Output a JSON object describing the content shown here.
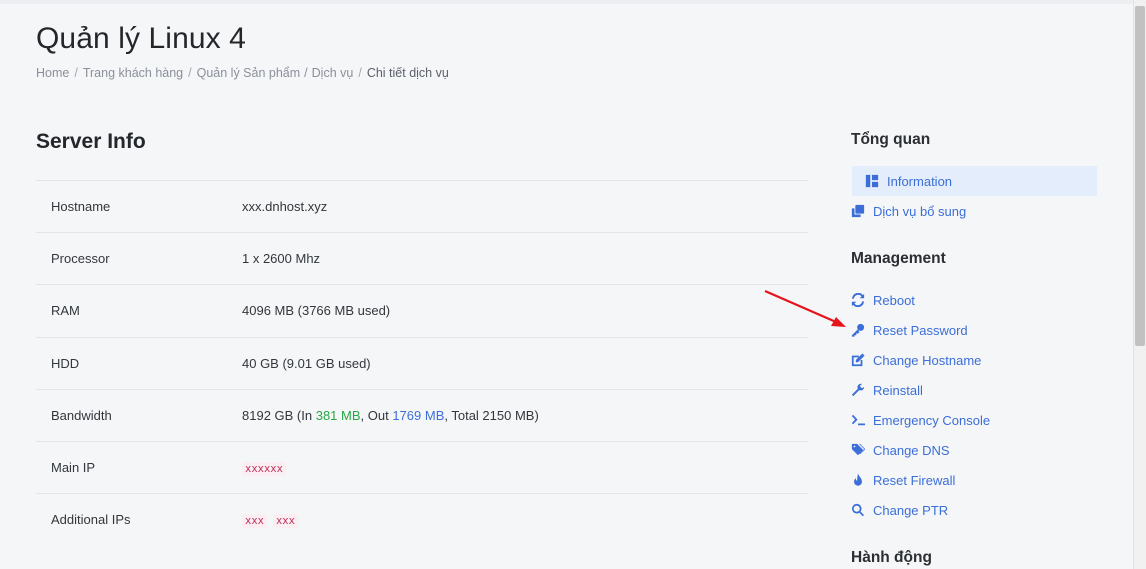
{
  "page": {
    "title": "Quản lý Linux 4",
    "breadcrumb": [
      "Home",
      "Trang khách hàng",
      "Quản lý Sản phẩm",
      "Dịch vụ",
      "Chi tiết dịch vụ"
    ]
  },
  "server_info": {
    "title": "Server Info",
    "rows": [
      {
        "label": "Hostname",
        "value": "xxx.dnhost.xyz"
      },
      {
        "label": "Processor",
        "value": "1 x 2600 Mhz"
      },
      {
        "label": "RAM",
        "value": "4096 MB (3766 MB used)"
      },
      {
        "label": "HDD",
        "value": "40 GB (9.01 GB used)"
      },
      {
        "label": "Bandwidth",
        "value_prefix": "8192 GB (In ",
        "in": "381 MB",
        "mid": ", Out ",
        "out": "1769 MB",
        "suffix": ", Total 2150 MB)"
      },
      {
        "label": "Main IP",
        "ips": [
          "xxxxxx"
        ]
      },
      {
        "label": "Additional IPs",
        "ips": [
          "xxx",
          "xxx"
        ]
      }
    ]
  },
  "sidebar": {
    "overview_title": "Tổng quan",
    "overview_items": [
      {
        "label": "Information",
        "icon": "dashboard-icon",
        "active": true
      },
      {
        "label": "Dịch vụ bổ sung",
        "icon": "clone-icon",
        "active": false
      }
    ],
    "management_title": "Management",
    "management_items": [
      {
        "label": "Reboot",
        "icon": "sync-icon"
      },
      {
        "label": "Reset Password",
        "icon": "key-icon"
      },
      {
        "label": "Change Hostname",
        "icon": "edit-icon"
      },
      {
        "label": "Reinstall",
        "icon": "wrench-icon"
      },
      {
        "label": "Emergency Console",
        "icon": "terminal-icon"
      },
      {
        "label": "Change DNS",
        "icon": "tags-icon"
      },
      {
        "label": "Reset Firewall",
        "icon": "fire-icon"
      },
      {
        "label": "Change PTR",
        "icon": "search-icon"
      }
    ],
    "actions_title": "Hành động"
  },
  "colors": {
    "link": "#3b6ed8",
    "green": "#28a745",
    "active_bg": "#e4edfb",
    "annotation_arrow": "#e5141b"
  }
}
